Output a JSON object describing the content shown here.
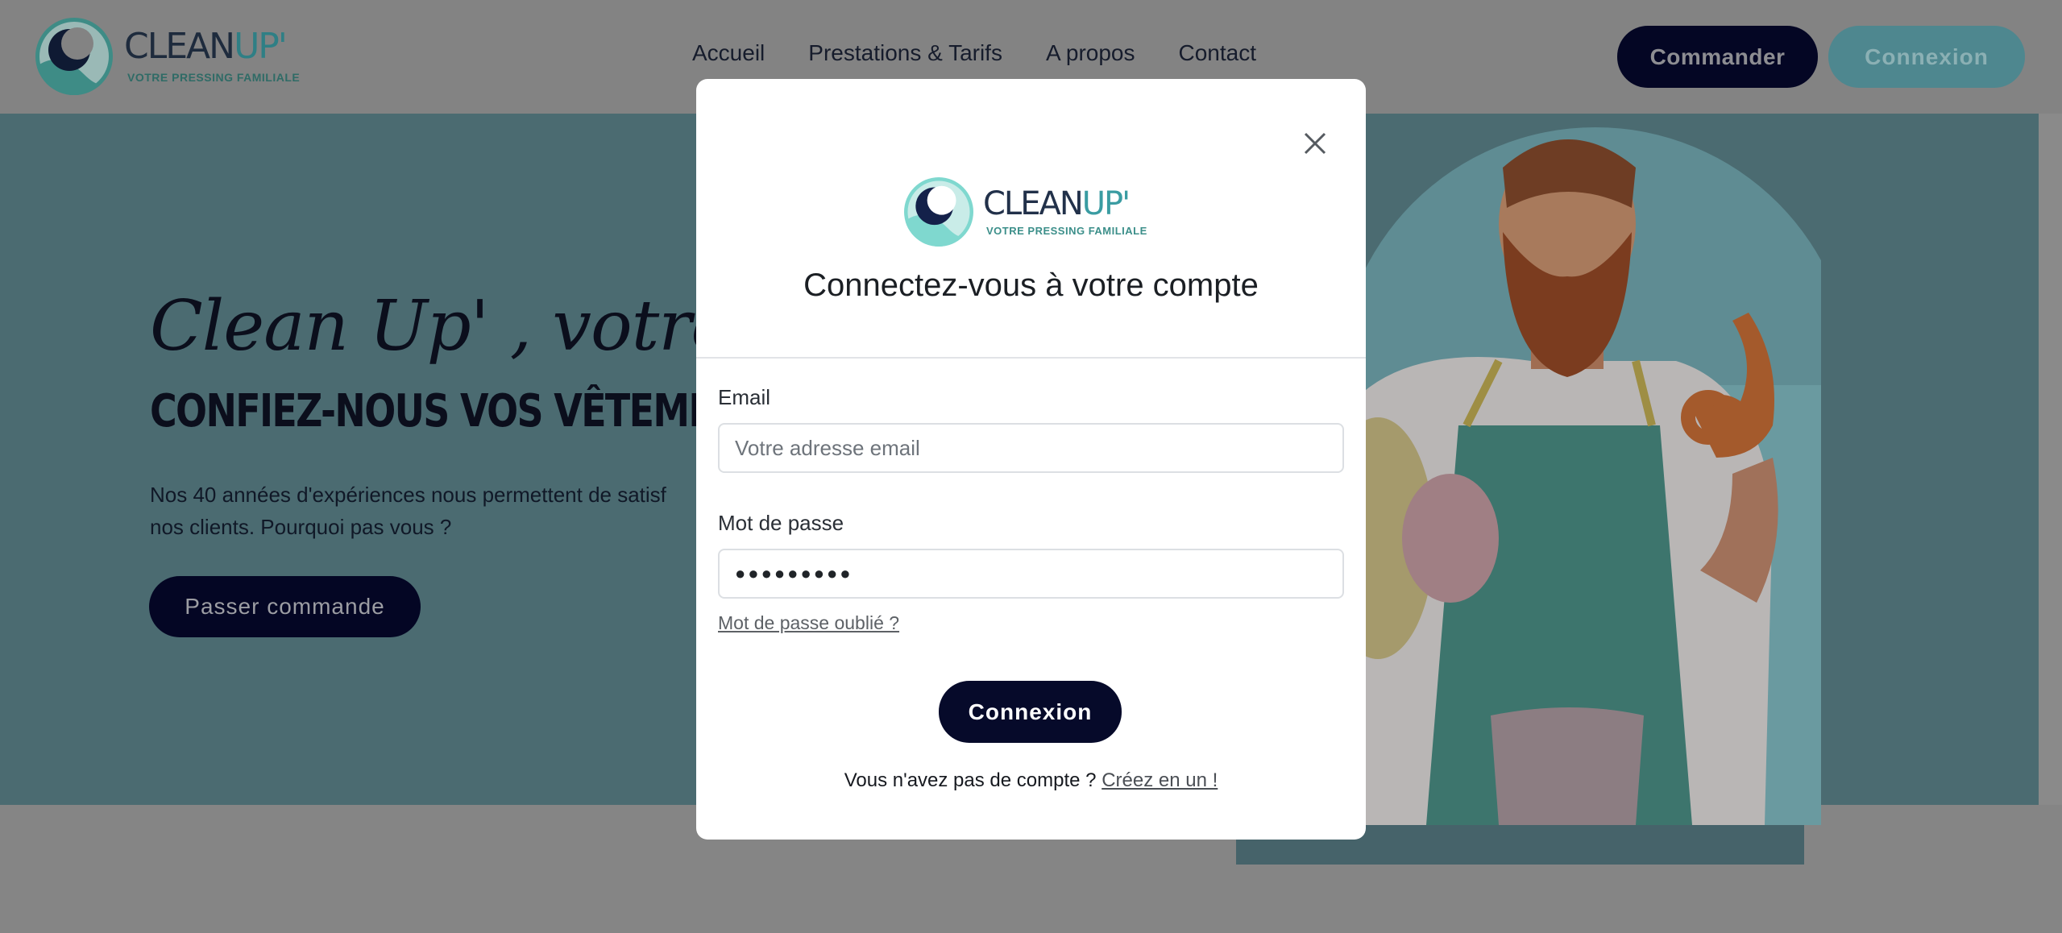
{
  "brand": {
    "name_main": "CLEAN",
    "name_accent": "UP'",
    "tagline": "VOTRE PRESSING FAMILIALE"
  },
  "nav": {
    "items": [
      {
        "label": "Accueil"
      },
      {
        "label": "Prestations & Tarifs"
      },
      {
        "label": "A propos"
      },
      {
        "label": "Contact"
      }
    ]
  },
  "header_actions": {
    "order_label": "Commander",
    "login_label": "Connexion"
  },
  "hero": {
    "script_title": "Clean Up' , votre pressi",
    "headline": "CONFIEZ-NOUS VOS VÊTEMENTS EN",
    "paragraph_line1": "Nos 40 années d'expériences nous permettent de satisf",
    "paragraph_line2": "nos clients. Pourquoi pas vous ?",
    "cta_label": "Passer commande"
  },
  "login_modal": {
    "title": "Connectez-vous à votre compte",
    "email_label": "Email",
    "email_placeholder": "Votre adresse email",
    "email_value": "",
    "password_label": "Mot de passe",
    "password_value": "●●●●●●●●●",
    "forgot_label": "Mot de passe oublié ?",
    "submit_label": "Connexion",
    "no_account_text": "Vous n'avez pas de compte ?",
    "create_account_label": "Créez en un !"
  },
  "colors": {
    "navy": "#040624",
    "teal": "#4e878f",
    "hero_bg": "#4b6b71",
    "overlay_header": "#838383"
  },
  "icons": {
    "close": "close-icon",
    "logo": "clean-up-logo-icon"
  }
}
